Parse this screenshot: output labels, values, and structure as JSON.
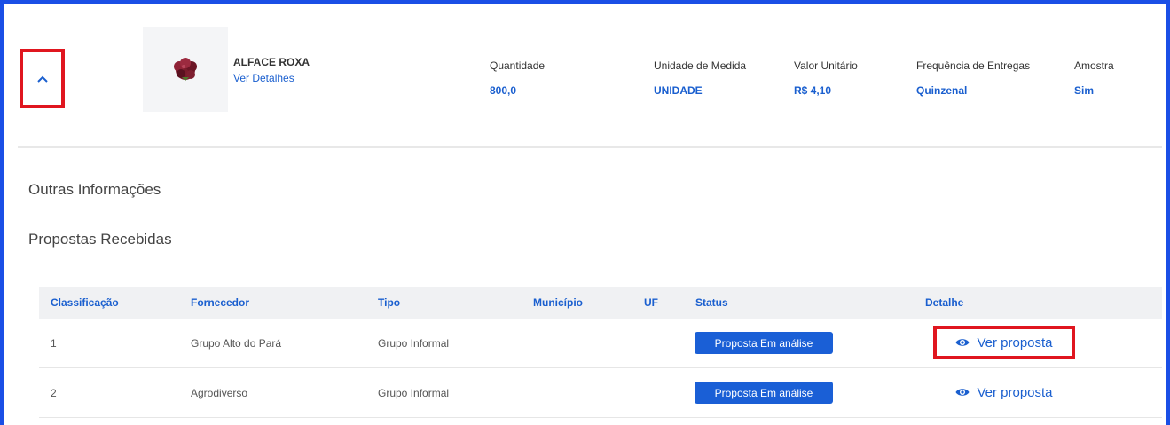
{
  "product": {
    "name": "ALFACE ROXA",
    "details_link": "Ver Detalhes",
    "attributes": [
      {
        "label": "Quantidade",
        "value": "800,0"
      },
      {
        "label": "Unidade de Medida",
        "value": "UNIDADE"
      },
      {
        "label": "Valor Unitário",
        "value": "R$ 4,10"
      },
      {
        "label": "Frequência de Entregas",
        "value": "Quinzenal"
      },
      {
        "label": "Amostra",
        "value": "Sim"
      }
    ]
  },
  "sections": {
    "other_info": "Outras Informações",
    "proposals": "Propostas Recebidas"
  },
  "table": {
    "headers": [
      "Classificação",
      "Fornecedor",
      "Tipo",
      "Município",
      "UF",
      "Status",
      "Detalhe"
    ],
    "rows": [
      {
        "rank": "1",
        "supplier": "Grupo Alto do Pará",
        "type": "Grupo Informal",
        "city": "",
        "uf": "",
        "status": "Proposta Em análise",
        "detail": "Ver proposta"
      },
      {
        "rank": "2",
        "supplier": "Agrodiverso",
        "type": "Grupo Informal",
        "city": "",
        "uf": "",
        "status": "Proposta Em análise",
        "detail": "Ver proposta"
      }
    ]
  },
  "icons": {
    "expand": "chevron-up-icon",
    "view": "eye-icon"
  },
  "colors": {
    "accent": "#1a5fcf",
    "highlight": "#e0161f",
    "frame": "#1a4fe6",
    "status_bg": "#1a5fd6"
  }
}
